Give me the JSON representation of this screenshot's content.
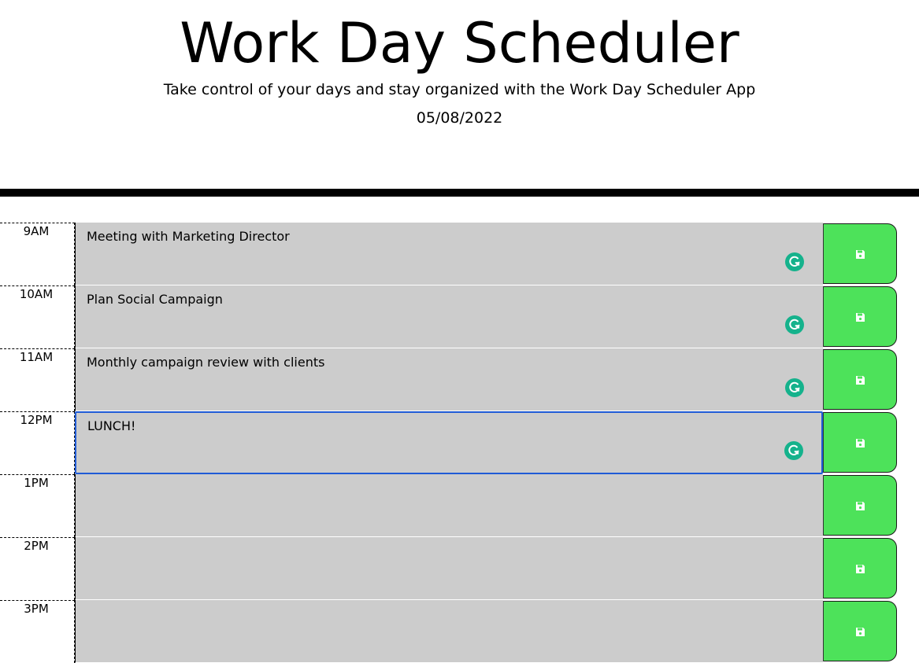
{
  "header": {
    "title": "Work Day Scheduler",
    "subtitle": "Take control of your days and stay organized with the Work Day Scheduler App",
    "date": "05/08/2022"
  },
  "colors": {
    "task_background": "#cccccc",
    "save_button": "#4de25a",
    "focus_border": "#1f5bd6",
    "grammarly": "#15b28c"
  },
  "rows": [
    {
      "hour": "9AM",
      "text": "Meeting with Marketing Director",
      "save_icon": "floppy-disk-icon"
    },
    {
      "hour": "10AM",
      "text": "Plan Social Campaign",
      "save_icon": "floppy-disk-icon"
    },
    {
      "hour": "11AM",
      "text": "Monthly campaign review with clients",
      "save_icon": "floppy-disk-icon"
    },
    {
      "hour": "12PM",
      "text": "LUNCH!",
      "save_icon": "floppy-disk-icon"
    },
    {
      "hour": "1PM",
      "text": "",
      "save_icon": "floppy-disk-icon"
    },
    {
      "hour": "2PM",
      "text": "",
      "save_icon": "floppy-disk-icon"
    },
    {
      "hour": "3PM",
      "text": "",
      "save_icon": "floppy-disk-icon"
    }
  ]
}
